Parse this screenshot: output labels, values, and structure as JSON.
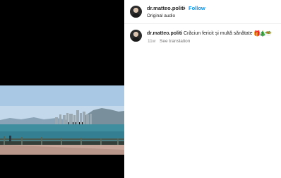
{
  "post": {
    "username": "dr.matteo.politi",
    "separator": "•",
    "follow_label": "Follow",
    "audio_label": "Original audio"
  },
  "comment": {
    "username": "dr.matteo.politi",
    "text": "Crăciun fericit și multă sănătate",
    "emojis": [
      "🎁",
      "🎄",
      "🥗"
    ],
    "age": "11w",
    "translate_label": "See translation"
  },
  "colors": {
    "follow": "#0095f6",
    "text_primary": "#262626",
    "text_secondary": "#8e8e8e"
  },
  "icons": {
    "avatar": "profile-avatar",
    "media": "harbor-skyline-video-frame"
  }
}
